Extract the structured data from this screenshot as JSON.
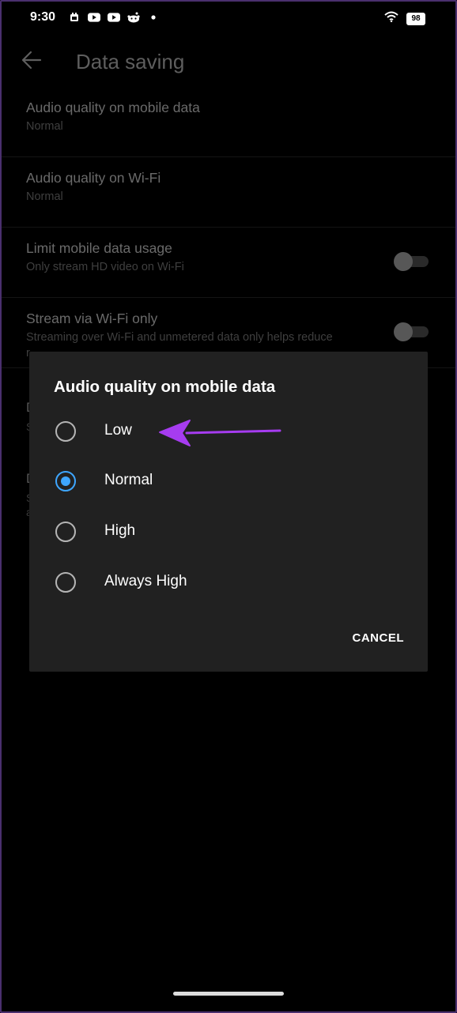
{
  "status_bar": {
    "time": "9:30",
    "left_icons": [
      "calendar-icon",
      "youtube-icon",
      "youtube-icon",
      "reddit-icon",
      "dot-icon"
    ],
    "battery": "98"
  },
  "header": {
    "title": "Data saving"
  },
  "settings": [
    {
      "title": "Audio quality on mobile data",
      "subtitle": "Normal"
    },
    {
      "title": "Audio quality on Wi-Fi",
      "subtitle": "Normal"
    },
    {
      "title": "Limit mobile data usage",
      "subtitle": "Only stream HD video on Wi-Fi",
      "toggle": false
    },
    {
      "title": "Stream via Wi-Fi only",
      "subtitle": "Streaming over Wi-Fi and unmetered data only helps reduce",
      "subtitle_cont": "r",
      "toggle": false
    }
  ],
  "obscured": {
    "item5_title_letter": "D",
    "item5_sub_letter": "S",
    "item6_title_letter": "D",
    "item6_sub_letter": "S",
    "item6_sub2_letter": "a"
  },
  "dialog": {
    "title": "Audio quality on mobile data",
    "options": [
      {
        "label": "Low",
        "selected": false
      },
      {
        "label": "Normal",
        "selected": true
      },
      {
        "label": "High",
        "selected": false
      },
      {
        "label": "Always High",
        "selected": false
      }
    ],
    "cancel_label": "CANCEL"
  },
  "colors": {
    "accent": "#3ea6ff",
    "annotation_arrow": "#a63cf0",
    "dialog_bg": "#212121"
  }
}
